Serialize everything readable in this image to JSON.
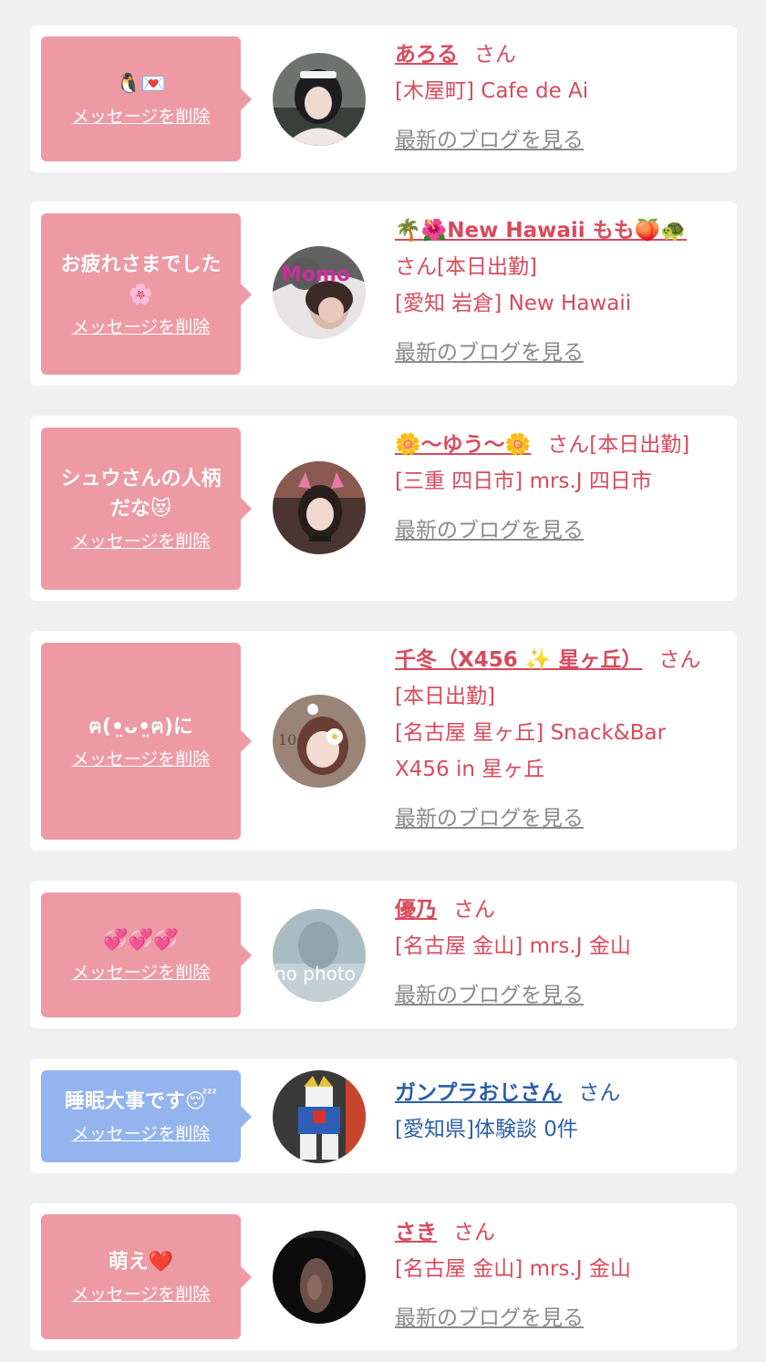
{
  "colors": {
    "page_bg": "#f0f0f0",
    "card_bg": "#ffffff",
    "bubble_pink": "#ee9aa4",
    "bubble_blue": "#93b4ee",
    "name_pink": "#d84a5c",
    "name_blue": "#2b5ea8",
    "link_gray": "#8a8a8a"
  },
  "delete_label": "メッセージを削除",
  "blog_label": "最新のブログを見る",
  "items": [
    {
      "message": "🐧💌",
      "name": "あろる",
      "honorific": "さん",
      "shop": "[木屋町] Cafe de Ai",
      "avatar_icon": "maid-girl-photo"
    },
    {
      "message": "お疲れさまでした🌸",
      "name": "🌴🌺New Hawaii もも🍑🐢",
      "honorific": "さん[本日出勤]",
      "shop": "[愛知 岩倉] New Hawaii",
      "avatar_icon": "girl-photo"
    },
    {
      "message": "シュウさんの人柄だな😻",
      "name": "🌼〜ゆう〜🌼",
      "honorific": "さん[本日出勤]",
      "shop": "[三重 四日市] mrs.J 四日市",
      "avatar_icon": "cat-ears-girl-photo"
    },
    {
      "message": "ฅ(•̤ᴗ•̤ฅ)に",
      "name": "千冬（X456 ✨ 星ヶ丘）",
      "honorific": "さん[本日出勤]",
      "shop": "[名古屋 星ヶ丘] Snack&Bar X456 in 星ヶ丘",
      "avatar_icon": "flower-face-girl-photo"
    },
    {
      "message": "💞💞💞",
      "name": "優乃",
      "honorific": "さん",
      "shop": "[名古屋 金山] mrs.J 金山",
      "avatar_icon": "no-photo",
      "avatar_text": "no photo"
    },
    {
      "message": "睡眠大事です😴",
      "name": "ガンプラおじさん",
      "honorific": "さん",
      "shop": "[愛知県]体験談 0件",
      "avatar_icon": "gundam-photo"
    },
    {
      "message": "萌え❤️",
      "name": "さき",
      "honorific": "さん",
      "shop": "[名古屋 金山] mrs.J 金山",
      "avatar_icon": "dark-girl-photo"
    }
  ]
}
